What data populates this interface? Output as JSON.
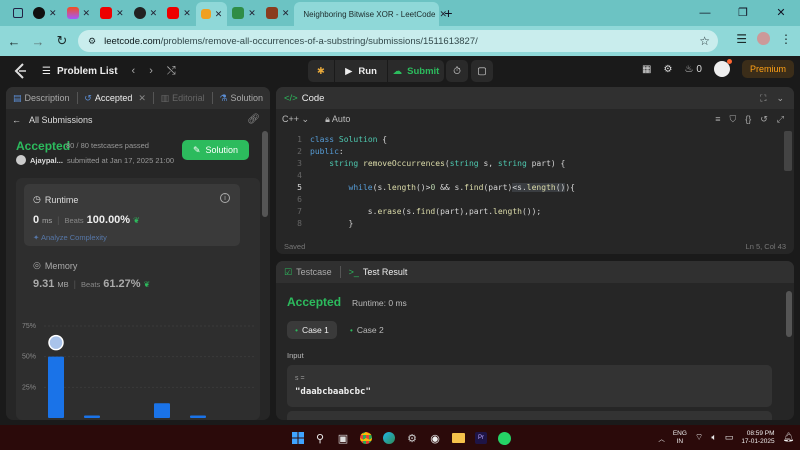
{
  "browser": {
    "active_tab_title": "Neighboring Bitwise XOR - LeetCode",
    "url_domain": "leetcode.com",
    "url_path": "/problems/remove-all-occurrences-of-a-substring/submissions/1511613827/",
    "new_tab": "+",
    "colors": {
      "tabbar": "#6cc3c3",
      "address_bar": "#8fd8d8"
    }
  },
  "nav": {
    "problem_list": "Problem List",
    "run": "Run",
    "submit": "Submit",
    "streak": "0",
    "premium": "Premium"
  },
  "left_panel": {
    "tabs": [
      {
        "label": "Description"
      },
      {
        "label": "Accepted"
      },
      {
        "label": "Editorial"
      },
      {
        "label": "Solution"
      }
    ],
    "all_submissions": "All Submissions",
    "status": "Accepted",
    "testcases": "80 / 80 testcases passed",
    "user": "Ajaypal...",
    "submitted": "submitted at Jan 17, 2025 21:00",
    "solution_button": "Solution",
    "runtime": {
      "label": "Runtime",
      "value": "0",
      "unit": "ms",
      "beats_label": "Beats",
      "beats": "100.00%",
      "analyze": "Analyze Complexity"
    },
    "memory": {
      "label": "Memory",
      "value": "9.31",
      "unit": "MB",
      "beats_label": "Beats",
      "beats": "61.27%"
    }
  },
  "chart_data": {
    "type": "bar",
    "ytick_labels": [
      "75%",
      "50%",
      "25%"
    ],
    "ylim": [
      0,
      75
    ],
    "values": [
      50,
      2,
      12,
      2
    ],
    "highlight_index": 0,
    "bar_color": "#1a73e8"
  },
  "code_panel": {
    "title": "Code",
    "language": "C++",
    "mode": "Auto",
    "lines": [
      {
        "n": "1",
        "text": "class Solution {"
      },
      {
        "n": "2",
        "text": "public:"
      },
      {
        "n": "3",
        "text": "    string removeOccurrences(string s, string part) {"
      },
      {
        "n": "4",
        "text": ""
      },
      {
        "n": "5",
        "text": "        while(s.length()>0 && s.find(part)<s.length()){"
      },
      {
        "n": "6",
        "text": ""
      },
      {
        "n": "7",
        "text": "            s.erase(s.find(part),part.length());"
      },
      {
        "n": "8",
        "text": "        }"
      }
    ],
    "saved": "Saved",
    "cursor": "Ln 5, Col 43"
  },
  "result_panel": {
    "tab_testcase": "Testcase",
    "tab_result": "Test Result",
    "status": "Accepted",
    "runtime": "Runtime: 0 ms",
    "case1": "Case 1",
    "case2": "Case 2",
    "input_label": "Input",
    "var": "s =",
    "value": "\"daabcbaabcbc\""
  },
  "taskbar": {
    "lang_top": "ENG",
    "lang_bottom": "IN",
    "time": "08:59 PM",
    "date": "17-01-2025"
  }
}
